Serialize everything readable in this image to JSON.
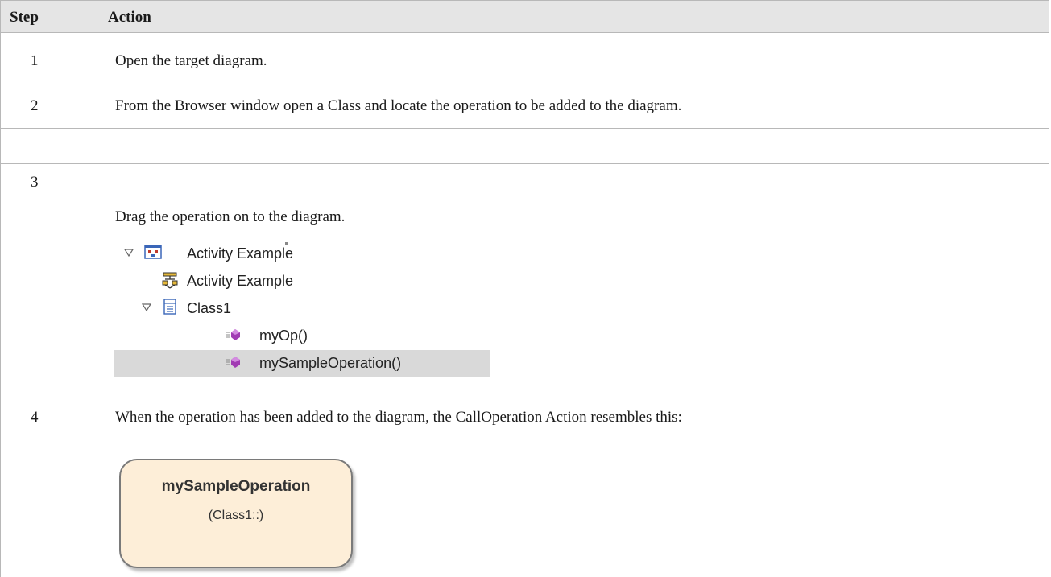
{
  "table": {
    "headers": {
      "step": "Step",
      "action": "Action"
    },
    "rows": [
      {
        "step": "1",
        "action": "Open the target diagram."
      },
      {
        "step": "2",
        "action": "From the Browser window open a Class and locate the operation to be added to the diagram."
      },
      {
        "step": "3",
        "action": "Drag the operation on to the diagram."
      },
      {
        "step": "4",
        "action": "When the operation has been added to the diagram, the CallOperation Action resembles this:"
      }
    ]
  },
  "browser_tree": {
    "items": [
      {
        "label": "Activity Example",
        "icon": "package-diagram-icon",
        "expanded": true
      },
      {
        "label": "Activity Example",
        "icon": "activity-diagram-icon"
      },
      {
        "label": "Class1",
        "icon": "class-icon",
        "expanded": true
      },
      {
        "label": "myOp()",
        "icon": "operation-icon"
      },
      {
        "label": "mySampleOperation()",
        "icon": "operation-icon",
        "selected": true
      }
    ]
  },
  "action_node": {
    "name": "mySampleOperation",
    "owner": "(Class1::)",
    "fill_color": "#fdeed8",
    "border_color": "#7a7a7a"
  },
  "colors": {
    "header_bg": "#e5e5e5",
    "grid": "#b8b8b8",
    "selected_row": "#d9d9d9"
  }
}
